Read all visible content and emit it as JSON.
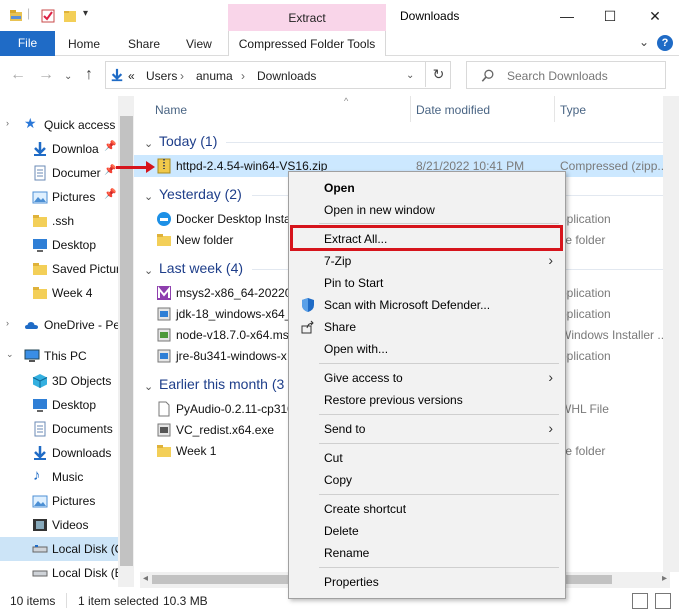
{
  "window": {
    "title": "Downloads",
    "context_tab_header": "Extract",
    "minimize": "—",
    "maximize": "☐",
    "close": "✕"
  },
  "ribbon": {
    "file": "File",
    "tabs": [
      "Home",
      "Share",
      "View"
    ],
    "context_tab": "Compressed Folder Tools",
    "help": "?"
  },
  "address": {
    "crumbs": [
      "«",
      "Users",
      "›",
      "anuma",
      "›",
      "Downloads"
    ],
    "search_placeholder": "Search Downloads"
  },
  "navigation": {
    "items": [
      {
        "label": "Quick access",
        "icon": "star-icon",
        "pinned": false
      },
      {
        "label": "Downloa",
        "icon": "download-arrow-icon",
        "pinned": true
      },
      {
        "label": "Documer",
        "icon": "document-icon",
        "pinned": true
      },
      {
        "label": "Pictures",
        "icon": "pictures-icon",
        "pinned": true
      },
      {
        "label": ".ssh",
        "icon": "folder-icon",
        "pinned": false
      },
      {
        "label": "Desktop",
        "icon": "desktop-icon",
        "pinned": false
      },
      {
        "label": "Saved Pictur",
        "icon": "folder-icon",
        "pinned": false
      },
      {
        "label": "Week 4",
        "icon": "folder-icon",
        "pinned": false
      },
      {
        "label": "OneDrive - Pe",
        "icon": "cloud-icon",
        "pinned": false
      },
      {
        "label": "This PC",
        "icon": "computer-icon",
        "pinned": false
      },
      {
        "label": "3D Objects",
        "icon": "cube-icon",
        "pinned": false
      },
      {
        "label": "Desktop",
        "icon": "desktop-icon",
        "pinned": false
      },
      {
        "label": "Documents",
        "icon": "document-icon",
        "pinned": false
      },
      {
        "label": "Downloads",
        "icon": "download-arrow-icon",
        "pinned": false
      },
      {
        "label": "Music",
        "icon": "music-note-icon",
        "pinned": false
      },
      {
        "label": "Pictures",
        "icon": "pictures-icon",
        "pinned": false
      },
      {
        "label": "Videos",
        "icon": "film-icon",
        "pinned": false
      },
      {
        "label": "Local Disk (C",
        "icon": "drive-icon",
        "pinned": false
      },
      {
        "label": "Local Disk (E",
        "icon": "drive-icon",
        "pinned": false
      }
    ]
  },
  "columns": {
    "name": "Name",
    "date": "Date modified",
    "type": "Type"
  },
  "groups": [
    {
      "label": "Today (1)"
    },
    {
      "label": "Yesterday (2)"
    },
    {
      "label": "Last week (4)"
    },
    {
      "label": "Earlier this month (3"
    }
  ],
  "files": [
    {
      "name": "httpd-2.4.54-win64-VS16.zip",
      "date": "8/21/2022 10:41 PM",
      "type": "Compressed (zipp...",
      "icon": "zip-icon"
    },
    {
      "name": "Docker Desktop Instal",
      "date": "",
      "type": "pplication",
      "icon": "docker-icon"
    },
    {
      "name": "New folder",
      "date": "",
      "type": "ile folder",
      "icon": "folder-icon"
    },
    {
      "name": "msys2-x86_64-2022062",
      "date": "",
      "type": "pplication",
      "icon": "msys-icon"
    },
    {
      "name": "jdk-18_windows-x64_",
      "date": "",
      "type": "pplication",
      "icon": "installer-icon"
    },
    {
      "name": "node-v18.7.0-x64.msi",
      "date": "",
      "type": "Windows Installer ...",
      "icon": "installer-icon"
    },
    {
      "name": "jre-8u341-windows-x",
      "date": "",
      "type": "pplication",
      "icon": "installer-icon"
    },
    {
      "name": "PyAudio-0.2.11-cp310",
      "date": "",
      "type": "WHL File",
      "icon": "file-icon"
    },
    {
      "name": "VC_redist.x64.exe",
      "date": "",
      "type": "",
      "icon": "installer-icon"
    },
    {
      "name": "Week 1",
      "date": "",
      "type": "ile folder",
      "icon": "folder-icon"
    }
  ],
  "context_menu": {
    "items": [
      {
        "label": "Open",
        "bold": true
      },
      {
        "label": "Open in new window"
      },
      {
        "label": "Extract All..."
      },
      {
        "label": "7-Zip",
        "submenu": true
      },
      {
        "label": "Pin to Start"
      },
      {
        "label": "Scan with Microsoft Defender...",
        "icon": "defender-shield-icon"
      },
      {
        "label": "Share",
        "icon": "share-icon"
      },
      {
        "label": "Open with..."
      },
      {
        "label": "Give access to",
        "submenu": true
      },
      {
        "label": "Restore previous versions"
      },
      {
        "label": "Send to",
        "submenu": true
      },
      {
        "label": "Cut"
      },
      {
        "label": "Copy"
      },
      {
        "label": "Create shortcut"
      },
      {
        "label": "Delete"
      },
      {
        "label": "Rename"
      },
      {
        "label": "Properties"
      }
    ],
    "submenu_glyph": "›"
  },
  "status": {
    "items_count": "10 items",
    "selected": "1 item selected",
    "size": "10.3 MB"
  },
  "colors": {
    "accent": "#1f6bc6",
    "context_tab": "#f9d5e9",
    "highlight": "#d6141c",
    "selection": "#cce8ff"
  }
}
